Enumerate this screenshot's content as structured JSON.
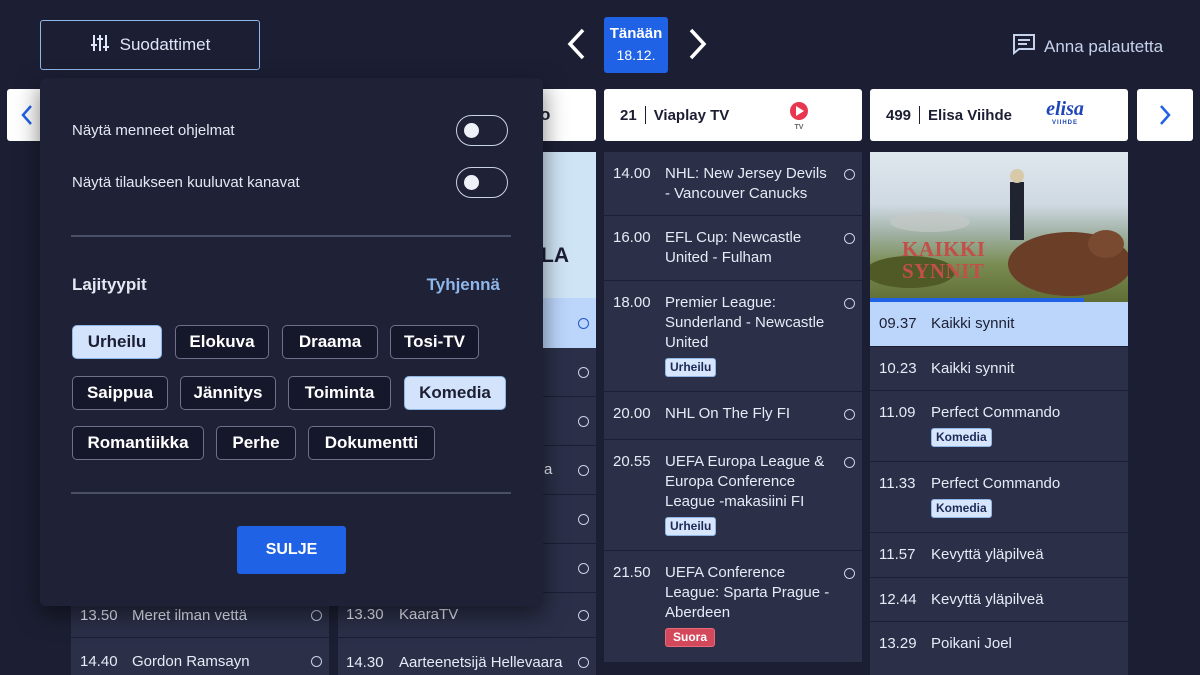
{
  "header": {
    "filters_label": "Suodattimet",
    "today_label": "Tänään",
    "today_date": "18.12.",
    "feedback_label": "Anna palautetta"
  },
  "channels": [
    {
      "number": "21",
      "name": "Viaplay TV",
      "logo_icon": "viaplay-logo",
      "logo_sub": "TV"
    },
    {
      "number": "499",
      "name": "Elisa Viihde",
      "logo_icon": "elisa-logo",
      "logo_text": "elisa",
      "logo_sub": "VIIHDE"
    }
  ],
  "partial_header_suffix": "o",
  "col1_bottom": [
    {
      "time": "13.50",
      "title": "Meret ilman vettä"
    },
    {
      "time": "14.40",
      "title": "Gordon Ramsayn"
    }
  ],
  "col2_partial": {
    "image_text": "LA",
    "row_fragment": "a",
    "rows": [
      {
        "time": "13.30",
        "title": "KaaraTV"
      },
      {
        "time": "14.30",
        "title": "Aarteenetsijä Hellevaara"
      }
    ]
  },
  "viaplay_programs": [
    {
      "time": "14.00",
      "title": "NHL: New Jersey Devils - Vancouver Canucks"
    },
    {
      "time": "16.00",
      "title": "EFL Cup: Newcastle United - Fulham"
    },
    {
      "time": "18.00",
      "title": "Premier League: Sunderland - Newcastle United",
      "badge": "Urheilu"
    },
    {
      "time": "20.00",
      "title": "NHL On The Fly FI"
    },
    {
      "time": "20.55",
      "title": "UEFA Europa League & Europa Conference League -makasiini FI",
      "badge": "Urheilu"
    },
    {
      "time": "21.50",
      "title": "UEFA Conference League: Sparta Prague - Aberdeen",
      "badge_live": "Suora"
    }
  ],
  "elisa_programs": [
    {
      "time": "09.37",
      "title": "Kaikki synnit"
    },
    {
      "time": "10.23",
      "title": "Kaikki synnit"
    },
    {
      "time": "11.09",
      "title": "Perfect Commando",
      "badge": "Komedia"
    },
    {
      "time": "11.33",
      "title": "Perfect Commando",
      "badge": "Komedia"
    },
    {
      "time": "11.57",
      "title": "Kevyttä yläpilveä"
    },
    {
      "time": "12.44",
      "title": "Kevyttä yläpilveä"
    },
    {
      "time": "13.29",
      "title": "Poikani Joel"
    }
  ],
  "elisa_thumbnail": {
    "overlay_line1": "KAIKKI",
    "overlay_line2": "SYNNIT",
    "progress_fraction": 0.83
  },
  "filter_panel": {
    "toggle_past": "Näytä menneet ohjelmat",
    "toggle_subscription": "Näytä tilaukseen kuuluvat kanavat",
    "genres_title": "Lajityypit",
    "clear_label": "Tyhjennä",
    "genres": [
      {
        "label": "Urheilu",
        "selected": true
      },
      {
        "label": "Elokuva",
        "selected": false
      },
      {
        "label": "Draama",
        "selected": false
      },
      {
        "label": "Tosi-TV",
        "selected": false
      },
      {
        "label": "Saippua",
        "selected": false
      },
      {
        "label": "Jännitys",
        "selected": false
      },
      {
        "label": "Toiminta",
        "selected": false
      },
      {
        "label": "Komedia",
        "selected": true
      },
      {
        "label": "Romantiikka",
        "selected": false
      },
      {
        "label": "Perhe",
        "selected": false
      },
      {
        "label": "Dokumentti",
        "selected": false
      }
    ],
    "close_label": "SULJE"
  },
  "colors": {
    "accent": "#2062e6",
    "background": "#1c1f33",
    "selected_row": "#bcd5fb",
    "live_badge": "#d4485c"
  }
}
